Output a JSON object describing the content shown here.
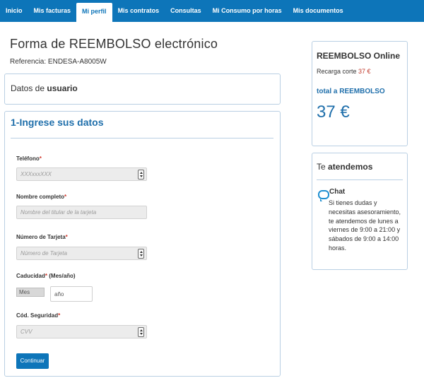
{
  "nav": {
    "items": [
      "Inicio",
      "Mis facturas",
      "Mi perfil",
      "Mis contratos",
      "Consultas",
      "Mi Consumo por horas",
      "Mis documentos"
    ],
    "active_index": 2
  },
  "page": {
    "title": "Forma de REEMBOLSO electrónico",
    "reference_label": "Referencia:",
    "reference_value": "ENDESA-A8005W"
  },
  "user_panel": {
    "prefix": "Datos de",
    "bold": "usuario"
  },
  "form": {
    "title": "1-Ingrese sus datos",
    "required_mark": "*",
    "phone": {
      "label": "Teléfono",
      "placeholder": "XXXxxxXXX"
    },
    "name": {
      "label": "Nombre completo",
      "placeholder": "Nombre del titular de la tarjeta"
    },
    "card": {
      "label": "Número de Tarjeta",
      "placeholder": "Número de Tarjeta"
    },
    "expiry": {
      "label": "Caducidad",
      "suffix": " (Mes/año)",
      "month_value": "Mes",
      "year_placeholder": "año"
    },
    "cvv": {
      "label": "Cód. Seguridad",
      "placeholder": "CVV"
    },
    "submit_label": "Continuar"
  },
  "refund_box": {
    "title": "REEMBOLSO Online",
    "recharge_label": "Recarga corte",
    "recharge_amount": "37 €",
    "total_label": "total a REEMBOLSO",
    "total_amount": "37 €"
  },
  "support_box": {
    "title_prefix": "Te",
    "title_bold": "atendemos",
    "chat_title": "Chat",
    "chat_text": "Si tienes dudas y necesitas asesoramiento, te atendemos de lunes a viernes de 9:00 a 21:00 y sábados de 9:00 a 14:00 horas."
  },
  "colors": {
    "brand_blue": "#0d75b9",
    "accent_blue": "#1f6fab",
    "required_red": "#d13a2e"
  }
}
